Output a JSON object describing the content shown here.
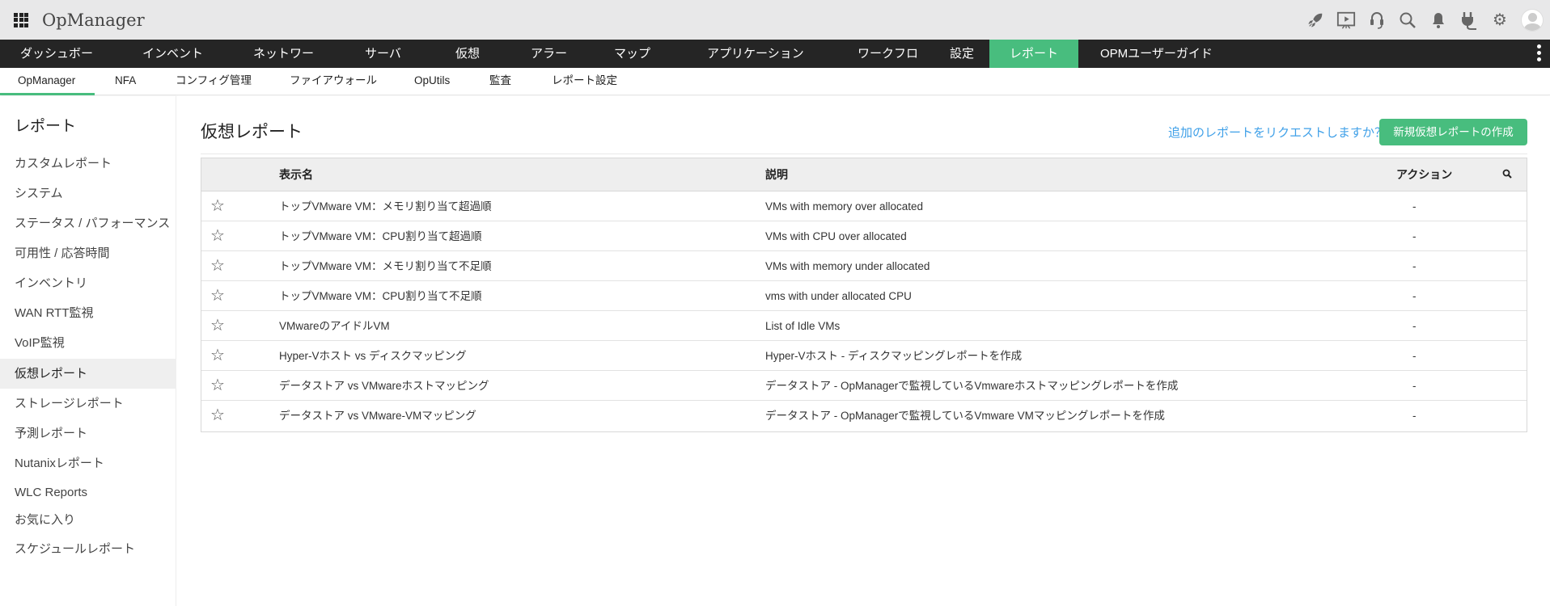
{
  "app": {
    "title": "OpManager"
  },
  "top_icons": [
    "rocket-icon",
    "presentation-icon",
    "headset-icon",
    "search-icon",
    "bell-icon",
    "plug-icon",
    "gear-icon",
    "avatar"
  ],
  "nav": {
    "items": [
      "ダッシュボード",
      "インベントリ",
      "ネットワーク",
      "サーバー",
      "仮想化",
      "アラート",
      "マップ",
      "アプリケーション",
      "ワークフロー",
      "設定",
      "レポート",
      "OPMユーザーガイド"
    ],
    "active": "レポート"
  },
  "subnav": {
    "items": [
      "OpManager",
      "NFA",
      "コンフィグ管理",
      "ファイアウォール",
      "OpUtils",
      "監査",
      "レポート設定"
    ],
    "active": "OpManager"
  },
  "sidebar": {
    "heading": "レポート",
    "items": [
      "カスタムレポート",
      "システム",
      "ステータス / パフォーマンス",
      "可用性 / 応答時間",
      "インベントリ",
      "WAN RTT監視",
      "VoIP監視",
      "仮想レポート",
      "ストレージレポート",
      "予測レポート",
      "Nutanixレポート",
      "WLC Reports",
      "お気に入り",
      "スケジュールレポート"
    ],
    "active": "仮想レポート"
  },
  "main": {
    "title": "仮想レポート",
    "request_link": "追加のレポートをリクエストしますか？",
    "new_button": "新規仮想レポートの作成"
  },
  "table": {
    "headers": {
      "name": "表示名",
      "description": "説明",
      "action": "アクション"
    },
    "rows": [
      {
        "name": "トップVMware VM：メモリ割り当て超過順",
        "description": "VMs with memory over allocated",
        "action": "-"
      },
      {
        "name": "トップVMware VM：CPU割り当て超過順",
        "description": "VMs with CPU over allocated",
        "action": "-"
      },
      {
        "name": "トップVMware VM：メモリ割り当て不足順",
        "description": "VMs with memory under allocated",
        "action": "-"
      },
      {
        "name": "トップVMware VM：CPU割り当て不足順",
        "description": "vms with under allocated CPU",
        "action": "-"
      },
      {
        "name": "VMwareのアイドルVM",
        "description": "List of Idle VMs",
        "action": "-"
      },
      {
        "name": "Hyper-Vホスト vs ディスクマッピング",
        "description": "Hyper-Vホスト - ディスクマッピングレポートを作成",
        "action": "-"
      },
      {
        "name": "データストア vs VMwareホストマッピング",
        "description": "データストア - OpManagerで監視しているVmwareホストマッピングレポートを作成",
        "action": "-"
      },
      {
        "name": "データストア vs VMware-VMマッピング",
        "description": "データストア - OpManagerで監視しているVmware VMマッピングレポートを作成",
        "action": "-"
      }
    ]
  },
  "colors": {
    "accent": "#48bd7e",
    "nav_bg": "#252525",
    "link": "#3fa0e8"
  }
}
